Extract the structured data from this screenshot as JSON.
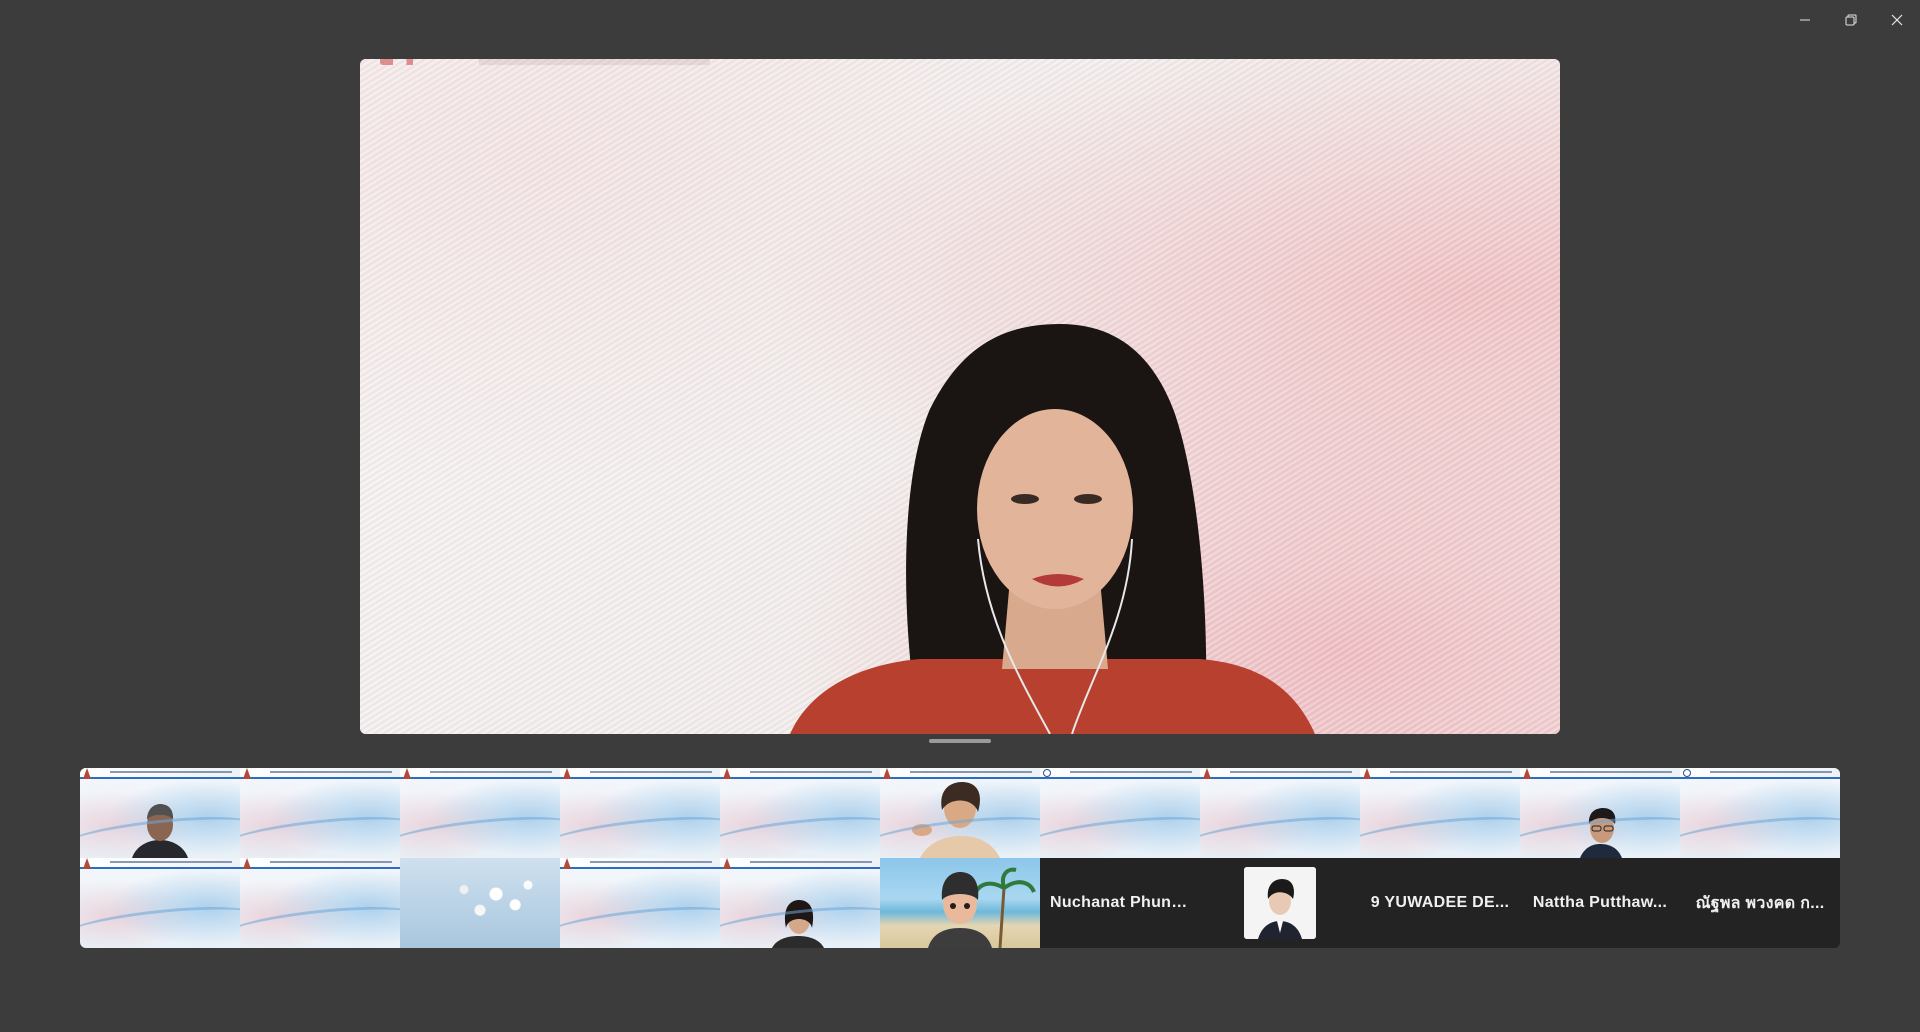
{
  "window": {
    "controls": {
      "minimize": "minimize",
      "restore": "restore",
      "close": "close"
    }
  },
  "colors": {
    "background": "#3c3c3c",
    "gallery_bg": "#232323",
    "slide_accent": "#2b6cc4"
  },
  "gallery": {
    "rows": [
      [
        {
          "type": "person-slide",
          "icon": "participant-video"
        },
        {
          "type": "slide",
          "icon": "participant-video"
        },
        {
          "type": "slide",
          "icon": "participant-video"
        },
        {
          "type": "slide",
          "icon": "participant-video"
        },
        {
          "type": "slide",
          "icon": "participant-video"
        },
        {
          "type": "person-slide",
          "icon": "participant-video"
        },
        {
          "type": "slide",
          "icon": "participant-video"
        },
        {
          "type": "slide",
          "icon": "participant-video"
        },
        {
          "type": "slide",
          "icon": "participant-video"
        },
        {
          "type": "person-slide",
          "icon": "participant-video"
        },
        {
          "type": "slide",
          "icon": "participant-video"
        }
      ],
      [
        {
          "type": "slide",
          "icon": "participant-video"
        },
        {
          "type": "slide",
          "icon": "participant-video"
        },
        {
          "type": "flowers",
          "icon": "participant-video"
        },
        {
          "type": "slide",
          "icon": "participant-video"
        },
        {
          "type": "person-slide",
          "icon": "participant-video"
        },
        {
          "type": "beach-avatar",
          "icon": "participant-video"
        },
        {
          "type": "name",
          "name": "Nuchanat  Phunt..."
        },
        {
          "type": "profile-picture",
          "icon": "profile-photo"
        },
        {
          "type": "name",
          "name": "9  YUWADEE  DE..."
        },
        {
          "type": "name",
          "name": "Nattha  Putthaw..."
        },
        {
          "type": "name",
          "name": "ณัฐพล  พวงคด  ก..."
        }
      ]
    ]
  }
}
